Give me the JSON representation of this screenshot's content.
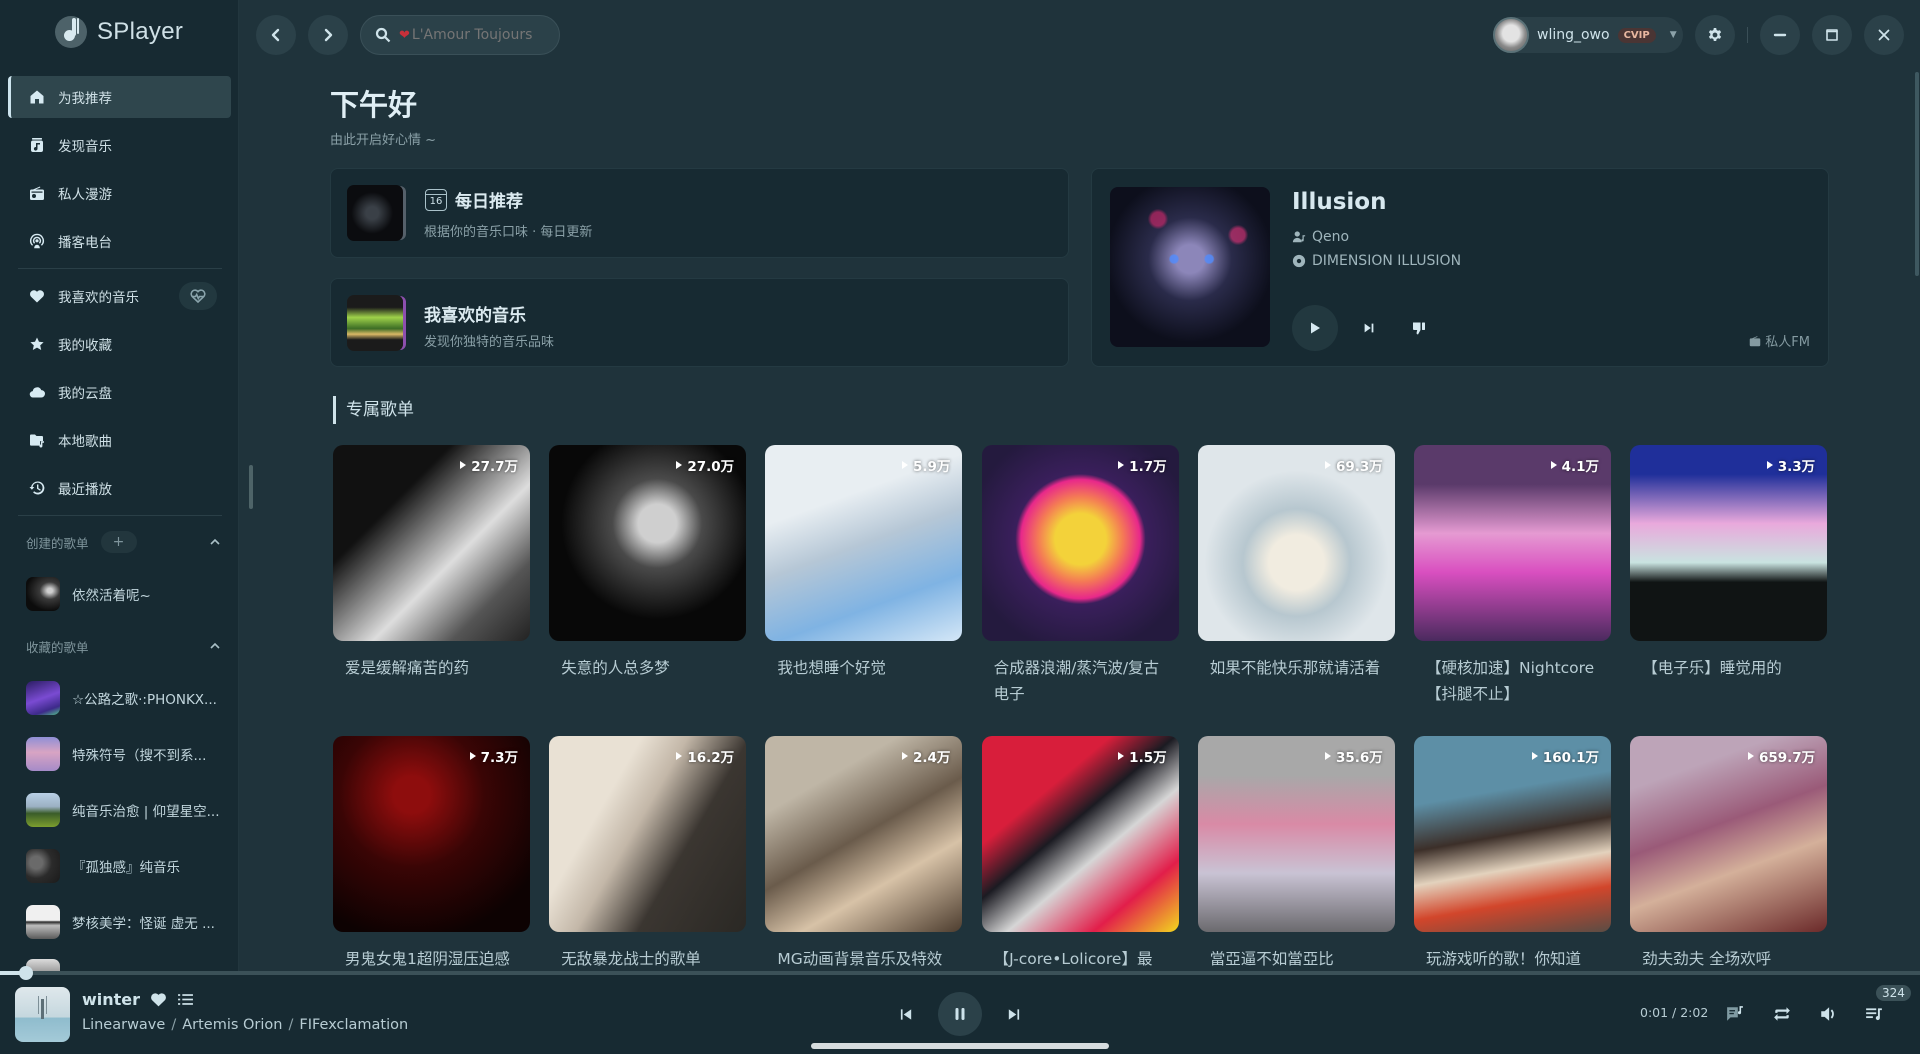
{
  "app": {
    "name": "SPlayer"
  },
  "sidebar": {
    "nav": [
      {
        "label": "为我推荐",
        "icon": "home-icon",
        "active": true
      },
      {
        "label": "发现音乐",
        "icon": "music-album-icon",
        "active": false
      },
      {
        "label": "私人漫游",
        "icon": "radio-icon",
        "active": false
      },
      {
        "label": "播客电台",
        "icon": "podcast-icon",
        "active": false
      }
    ],
    "library": [
      {
        "label": "我喜欢的音乐",
        "icon": "heart-icon"
      },
      {
        "label": "我的收藏",
        "icon": "star-icon"
      },
      {
        "label": "我的云盘",
        "icon": "cloud-icon"
      },
      {
        "label": "本地歌曲",
        "icon": "folder-music-icon"
      },
      {
        "label": "最近播放",
        "icon": "history-icon"
      }
    ],
    "heartbeat_mode_icon": "heart-pulse-icon",
    "created_header": "创建的歌单",
    "add_label": "+",
    "created_playlists": [
      {
        "name": "依然活着呢~"
      }
    ],
    "collected_header": "收藏的歌单",
    "collected_playlists": [
      {
        "name": "☆公路之歌·:PHONKX..."
      },
      {
        "name": "特殊符号（搜不到系..."
      },
      {
        "name": "纯音乐治愈 | 仰望星空..."
      },
      {
        "name": "『孤独感』纯音乐"
      },
      {
        "name": "梦核美学：怪诞 虚无 ..."
      }
    ]
  },
  "topbar": {
    "search_value": "L'Amour Toujours",
    "search_prefix_icon": "heart-emoji",
    "user": {
      "name": "wling_owo",
      "badge": "CVIP"
    }
  },
  "home": {
    "greeting": "下午好",
    "greeting_sub": "由此开启好心情 ~",
    "daily": {
      "title": "每日推荐",
      "calendar_day": "16",
      "subtitle": "根据你的音乐口味 · 每日更新"
    },
    "liked": {
      "title": "我喜欢的音乐",
      "subtitle": "发现你独特的音乐品味"
    },
    "fm": {
      "title": "Illusion",
      "artist": "Qeno",
      "album": "DIMENSION ILLUSION",
      "tag": "私人FM"
    },
    "section_title": "专属歌单",
    "playlists": [
      {
        "title": "爱是缓解痛苦的药",
        "count": "27.7万"
      },
      {
        "title": "失意的人总多梦",
        "count": "27.0万"
      },
      {
        "title": "我也想睡个好觉",
        "count": "5.9万"
      },
      {
        "title": "合成器浪潮/蒸汽波/复古电子",
        "count": "1.7万"
      },
      {
        "title": "如果不能快乐那就请活着",
        "count": "69.3万"
      },
      {
        "title": "【硬核加速】Nightcore【抖腿不止】",
        "count": "4.1万"
      },
      {
        "title": "【电子乐】睡觉用的",
        "count": "3.3万"
      },
      {
        "title": "男鬼女鬼1超阴湿压迫感",
        "count": "7.3万"
      },
      {
        "title": "无敌暴龙战士的歌单",
        "count": "16.2万"
      },
      {
        "title": "MG动画背景音乐及特效",
        "count": "2.4万"
      },
      {
        "title": "【J-core•Lolicore】最",
        "count": "1.5万"
      },
      {
        "title": "當亞逼不如當亞比",
        "count": "35.6万"
      },
      {
        "title": "玩游戏听的歌！你知道",
        "count": "160.1万"
      },
      {
        "title": "劲夫劲夫 全场欢呼",
        "count": "659.7万"
      }
    ]
  },
  "player": {
    "title": "winter",
    "liked": true,
    "artists": [
      "Linearwave",
      "Artemis Orion",
      "FIFexclamation"
    ],
    "current_time": "0:01",
    "duration": "2:02",
    "time_display": "0:01 / 2:02",
    "progress_fraction": 0.008,
    "queue_count": "324"
  },
  "colors": {
    "bg": "#1f333b",
    "sidebar_bg": "#172a32",
    "accent": "#cfe3ea",
    "card_bg": "#172a32"
  }
}
